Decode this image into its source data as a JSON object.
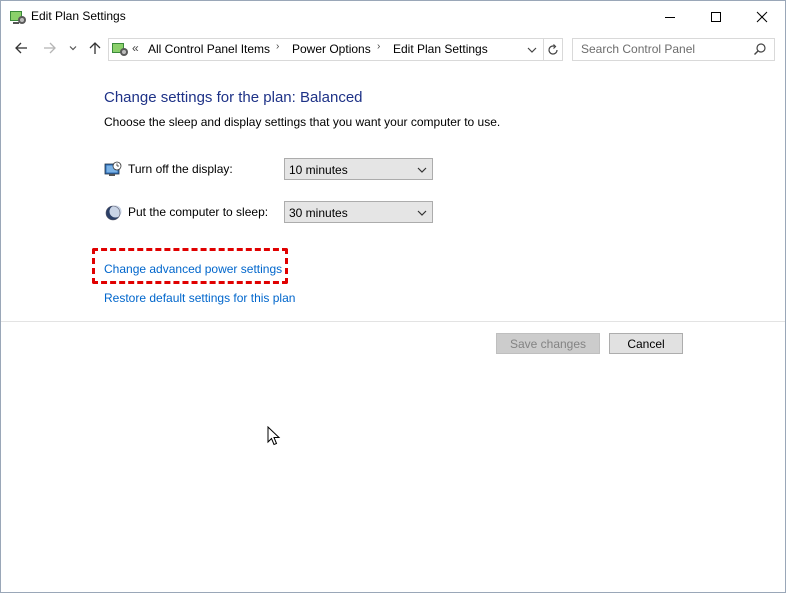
{
  "window": {
    "title": "Edit Plan Settings",
    "icons": {
      "app": "power-options-icon",
      "minimize": "minimize-icon",
      "maximize": "maximize-icon",
      "close": "close-icon"
    }
  },
  "nav": {
    "back_icon": "back-arrow-icon",
    "forward_icon": "forward-arrow-icon",
    "recent_icon": "chevron-down-icon",
    "up_icon": "up-arrow-icon"
  },
  "address": {
    "overflow": "«",
    "crumbs": [
      "All Control Panel Items",
      "Power Options",
      "Edit Plan Settings"
    ],
    "separator": "›"
  },
  "search": {
    "placeholder": "Search Control Panel"
  },
  "content": {
    "heading": "Change settings for the plan: Balanced",
    "subtext": "Choose the sleep and display settings that you want your computer to use.",
    "display": {
      "label": "Turn off the display:",
      "value": "10 minutes"
    },
    "sleep": {
      "label": "Put the computer to sleep:",
      "value": "30 minutes"
    },
    "advanced_link": "Change advanced power settings",
    "restore_link": "Restore default settings for this plan"
  },
  "buttons": {
    "save": "Save changes",
    "cancel": "Cancel"
  },
  "colors": {
    "heading": "#1e3287",
    "link": "#0066cc",
    "highlight": "#e00000"
  }
}
